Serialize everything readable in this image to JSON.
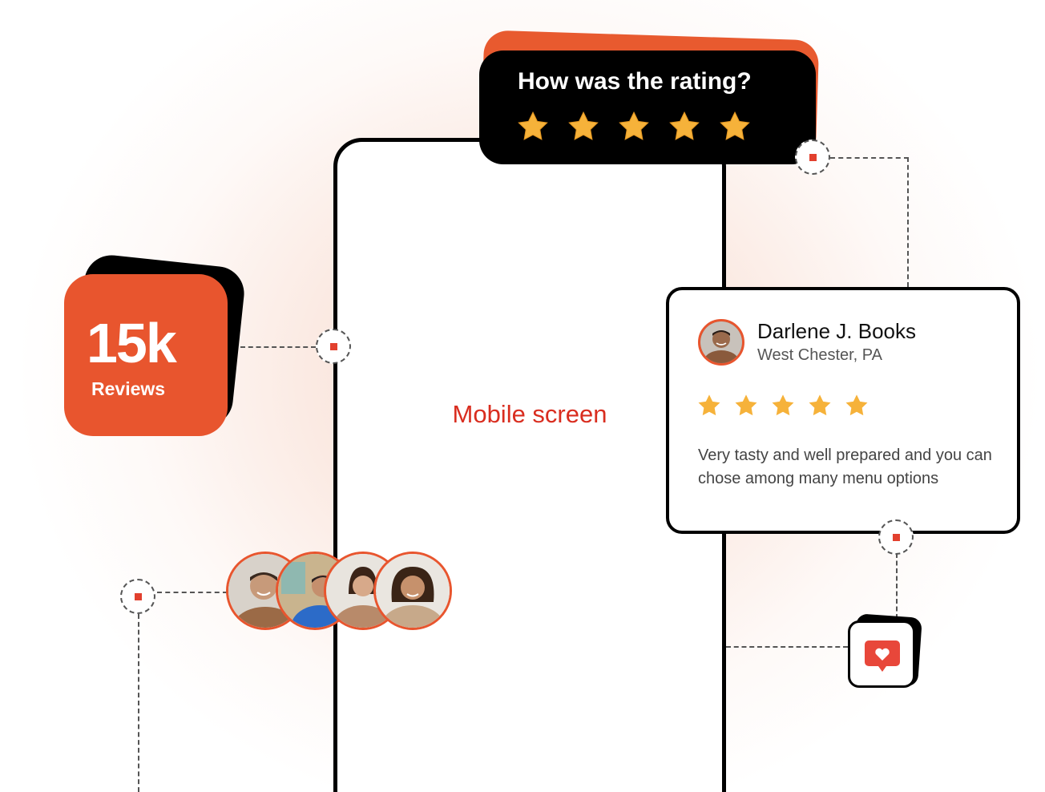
{
  "rating_prompt": {
    "title": "How was the rating?",
    "stars_filled": 5,
    "stars_total": 5
  },
  "reviews_badge": {
    "count": "15k",
    "label": "Reviews"
  },
  "phone": {
    "placeholder": "Mobile screen"
  },
  "review": {
    "name": "Darlene J. Books",
    "location": "West Chester, PA",
    "stars_filled": 5,
    "text": "Very tasty and well prepared and you can chose among many menu options"
  },
  "avatars": [
    {
      "icon": "user-avatar-man-smiling"
    },
    {
      "icon": "user-avatar-man-blue-shirt"
    },
    {
      "icon": "user-avatar-woman-reading"
    },
    {
      "icon": "user-avatar-woman-smiling"
    }
  ],
  "heart_button": {
    "icon": "heart-chat-icon"
  },
  "colors": {
    "accent": "#e8552e",
    "node_dot": "#e2402e",
    "phone_label": "#d92d1f",
    "star": "#f6b23a",
    "dark": "#000000"
  }
}
